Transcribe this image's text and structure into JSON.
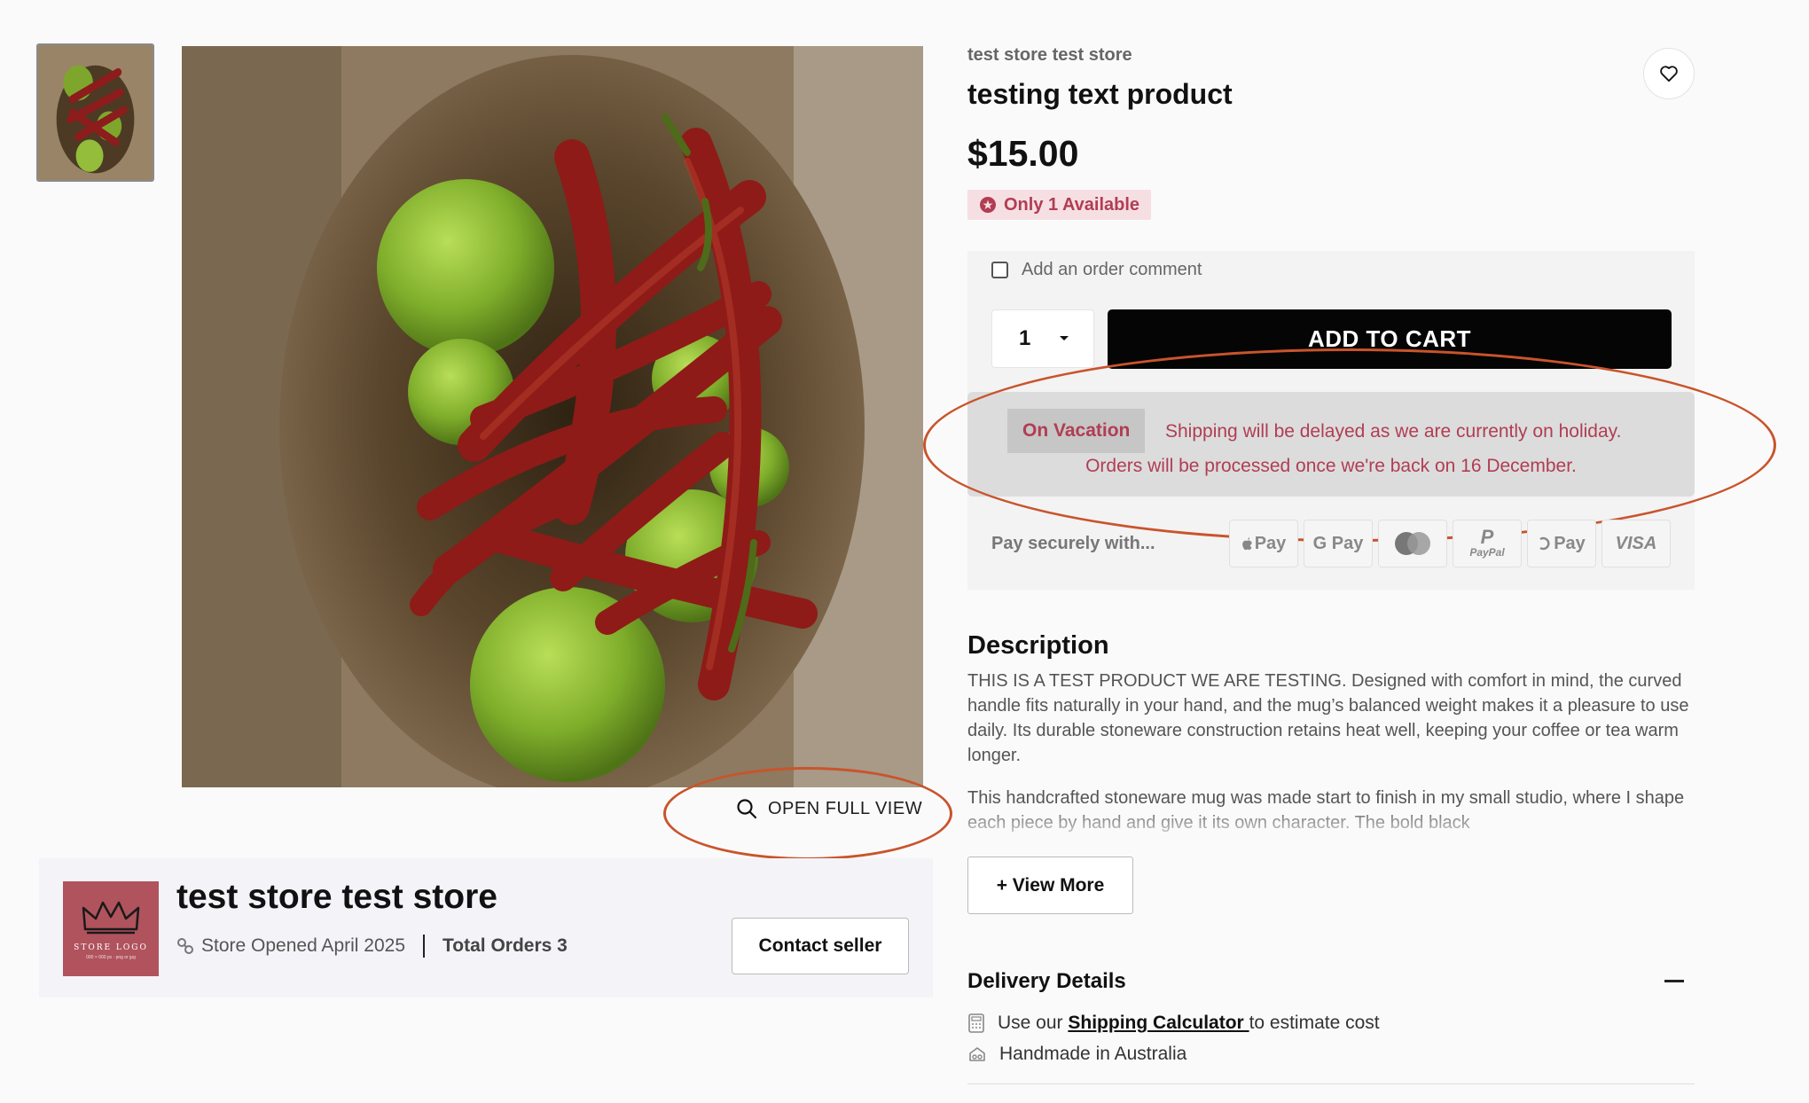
{
  "gallery": {
    "open_full_view": "OPEN FULL VIEW"
  },
  "seller": {
    "name": "test store test store",
    "opened": "Store Opened April 2025",
    "orders": "Total Orders 3",
    "contact_label": "Contact seller",
    "logo_text": "STORE LOGO",
    "logo_sub": "000 × 000 px · png or jpg"
  },
  "product": {
    "store": "test store test store",
    "title": "testing text product",
    "price": "$15.00",
    "stock": "Only 1 Available"
  },
  "buy_box": {
    "comment_label": "Add an order comment",
    "quantity": "1",
    "add_to_cart": "ADD TO CART"
  },
  "vacation": {
    "tag": "On Vacation",
    "line1": "Shipping will be delayed as we are currently on holiday.",
    "line2": "Orders will be processed once we're back on 16 December."
  },
  "payment": {
    "label": "Pay securely with...",
    "methods": [
      "Apple Pay",
      "Google Pay",
      "Mastercard",
      "PayPal",
      "Shop Pay",
      "VISA"
    ],
    "apple": "Pay",
    "google": "G Pay",
    "paypal": "PayPal",
    "shop": "Pay",
    "visa": "VISA"
  },
  "description": {
    "title": "Description",
    "p1": "THIS IS A TEST PRODUCT WE ARE TESTING. Designed with comfort in mind, the curved handle fits naturally in your hand, and the mug’s balanced weight makes it a pleasure to use daily. Its durable stoneware construction retains heat well, keeping your coffee or tea warm longer.",
    "p2": "This handcrafted stoneware mug was made start to finish in my small studio, where I shape each piece by hand and give it its own character. The bold black",
    "view_more": "+ View More"
  },
  "delivery": {
    "title": "Delivery Details",
    "calc_prefix": "Use our ",
    "calc_link": "Shipping Calculator ",
    "calc_suffix": "to estimate cost",
    "origin": "Handmade in Australia"
  },
  "colors": {
    "accent_red": "#b13d53",
    "annotation_orange": "#c9542c",
    "cart_button": "#050505"
  }
}
